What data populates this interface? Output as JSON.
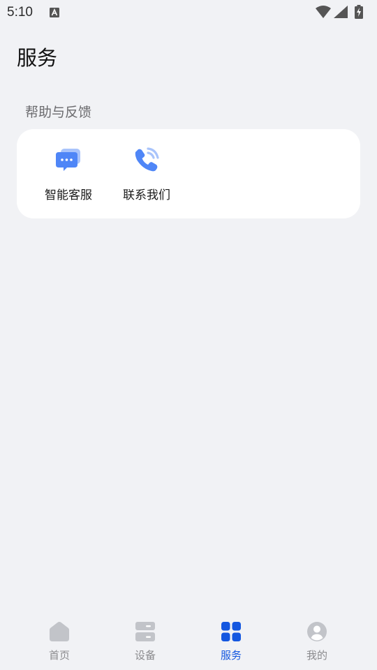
{
  "status_bar": {
    "time": "5:10",
    "icons": [
      "a-notification-icon",
      "wifi-icon",
      "signal-icon",
      "battery-charging-icon"
    ]
  },
  "page": {
    "title": "服务"
  },
  "sections": [
    {
      "label": "帮助与反馈",
      "items": [
        {
          "label": "智能客服",
          "icon": "chat-bubbles-icon"
        },
        {
          "label": "联系我们",
          "icon": "phone-call-icon"
        }
      ]
    }
  ],
  "bottom_nav": {
    "active_index": 2,
    "items": [
      {
        "label": "首页",
        "icon": "home-icon"
      },
      {
        "label": "设备",
        "icon": "devices-icon"
      },
      {
        "label": "服务",
        "icon": "service-grid-icon"
      },
      {
        "label": "我的",
        "icon": "profile-icon"
      }
    ]
  },
  "colors": {
    "background": "#f1f2f5",
    "card": "#ffffff",
    "accent": "#1457e0",
    "icon_inactive": "#c2c4c9",
    "service_icon_blue": "#4f86f7",
    "service_icon_light": "#a9c4fb"
  }
}
